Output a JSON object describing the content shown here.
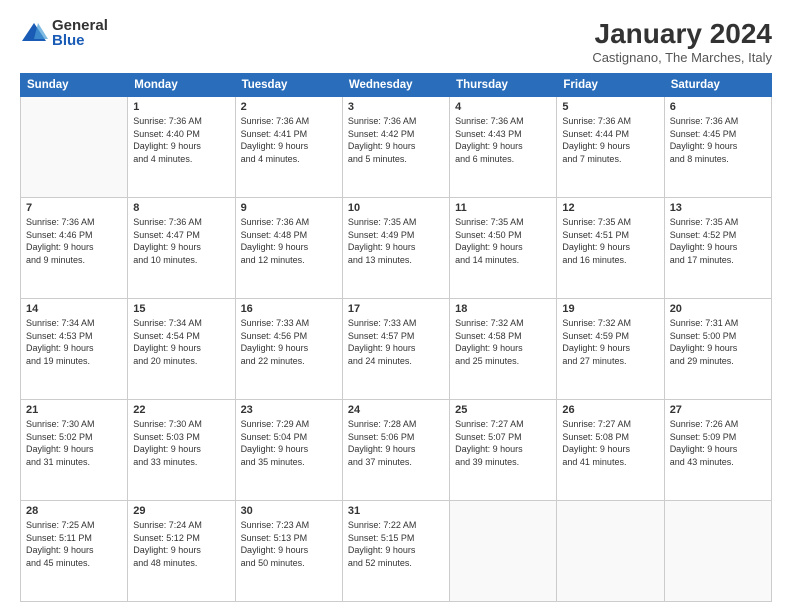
{
  "logo": {
    "general": "General",
    "blue": "Blue"
  },
  "title": "January 2024",
  "subtitle": "Castignano, The Marches, Italy",
  "headers": [
    "Sunday",
    "Monday",
    "Tuesday",
    "Wednesday",
    "Thursday",
    "Friday",
    "Saturday"
  ],
  "weeks": [
    [
      {
        "day": "",
        "info": ""
      },
      {
        "day": "1",
        "info": "Sunrise: 7:36 AM\nSunset: 4:40 PM\nDaylight: 9 hours\nand 4 minutes."
      },
      {
        "day": "2",
        "info": "Sunrise: 7:36 AM\nSunset: 4:41 PM\nDaylight: 9 hours\nand 4 minutes."
      },
      {
        "day": "3",
        "info": "Sunrise: 7:36 AM\nSunset: 4:42 PM\nDaylight: 9 hours\nand 5 minutes."
      },
      {
        "day": "4",
        "info": "Sunrise: 7:36 AM\nSunset: 4:43 PM\nDaylight: 9 hours\nand 6 minutes."
      },
      {
        "day": "5",
        "info": "Sunrise: 7:36 AM\nSunset: 4:44 PM\nDaylight: 9 hours\nand 7 minutes."
      },
      {
        "day": "6",
        "info": "Sunrise: 7:36 AM\nSunset: 4:45 PM\nDaylight: 9 hours\nand 8 minutes."
      }
    ],
    [
      {
        "day": "7",
        "info": "Sunrise: 7:36 AM\nSunset: 4:46 PM\nDaylight: 9 hours\nand 9 minutes."
      },
      {
        "day": "8",
        "info": "Sunrise: 7:36 AM\nSunset: 4:47 PM\nDaylight: 9 hours\nand 10 minutes."
      },
      {
        "day": "9",
        "info": "Sunrise: 7:36 AM\nSunset: 4:48 PM\nDaylight: 9 hours\nand 12 minutes."
      },
      {
        "day": "10",
        "info": "Sunrise: 7:35 AM\nSunset: 4:49 PM\nDaylight: 9 hours\nand 13 minutes."
      },
      {
        "day": "11",
        "info": "Sunrise: 7:35 AM\nSunset: 4:50 PM\nDaylight: 9 hours\nand 14 minutes."
      },
      {
        "day": "12",
        "info": "Sunrise: 7:35 AM\nSunset: 4:51 PM\nDaylight: 9 hours\nand 16 minutes."
      },
      {
        "day": "13",
        "info": "Sunrise: 7:35 AM\nSunset: 4:52 PM\nDaylight: 9 hours\nand 17 minutes."
      }
    ],
    [
      {
        "day": "14",
        "info": "Sunrise: 7:34 AM\nSunset: 4:53 PM\nDaylight: 9 hours\nand 19 minutes."
      },
      {
        "day": "15",
        "info": "Sunrise: 7:34 AM\nSunset: 4:54 PM\nDaylight: 9 hours\nand 20 minutes."
      },
      {
        "day": "16",
        "info": "Sunrise: 7:33 AM\nSunset: 4:56 PM\nDaylight: 9 hours\nand 22 minutes."
      },
      {
        "day": "17",
        "info": "Sunrise: 7:33 AM\nSunset: 4:57 PM\nDaylight: 9 hours\nand 24 minutes."
      },
      {
        "day": "18",
        "info": "Sunrise: 7:32 AM\nSunset: 4:58 PM\nDaylight: 9 hours\nand 25 minutes."
      },
      {
        "day": "19",
        "info": "Sunrise: 7:32 AM\nSunset: 4:59 PM\nDaylight: 9 hours\nand 27 minutes."
      },
      {
        "day": "20",
        "info": "Sunrise: 7:31 AM\nSunset: 5:00 PM\nDaylight: 9 hours\nand 29 minutes."
      }
    ],
    [
      {
        "day": "21",
        "info": "Sunrise: 7:30 AM\nSunset: 5:02 PM\nDaylight: 9 hours\nand 31 minutes."
      },
      {
        "day": "22",
        "info": "Sunrise: 7:30 AM\nSunset: 5:03 PM\nDaylight: 9 hours\nand 33 minutes."
      },
      {
        "day": "23",
        "info": "Sunrise: 7:29 AM\nSunset: 5:04 PM\nDaylight: 9 hours\nand 35 minutes."
      },
      {
        "day": "24",
        "info": "Sunrise: 7:28 AM\nSunset: 5:06 PM\nDaylight: 9 hours\nand 37 minutes."
      },
      {
        "day": "25",
        "info": "Sunrise: 7:27 AM\nSunset: 5:07 PM\nDaylight: 9 hours\nand 39 minutes."
      },
      {
        "day": "26",
        "info": "Sunrise: 7:27 AM\nSunset: 5:08 PM\nDaylight: 9 hours\nand 41 minutes."
      },
      {
        "day": "27",
        "info": "Sunrise: 7:26 AM\nSunset: 5:09 PM\nDaylight: 9 hours\nand 43 minutes."
      }
    ],
    [
      {
        "day": "28",
        "info": "Sunrise: 7:25 AM\nSunset: 5:11 PM\nDaylight: 9 hours\nand 45 minutes."
      },
      {
        "day": "29",
        "info": "Sunrise: 7:24 AM\nSunset: 5:12 PM\nDaylight: 9 hours\nand 48 minutes."
      },
      {
        "day": "30",
        "info": "Sunrise: 7:23 AM\nSunset: 5:13 PM\nDaylight: 9 hours\nand 50 minutes."
      },
      {
        "day": "31",
        "info": "Sunrise: 7:22 AM\nSunset: 5:15 PM\nDaylight: 9 hours\nand 52 minutes."
      },
      {
        "day": "",
        "info": ""
      },
      {
        "day": "",
        "info": ""
      },
      {
        "day": "",
        "info": ""
      }
    ]
  ]
}
